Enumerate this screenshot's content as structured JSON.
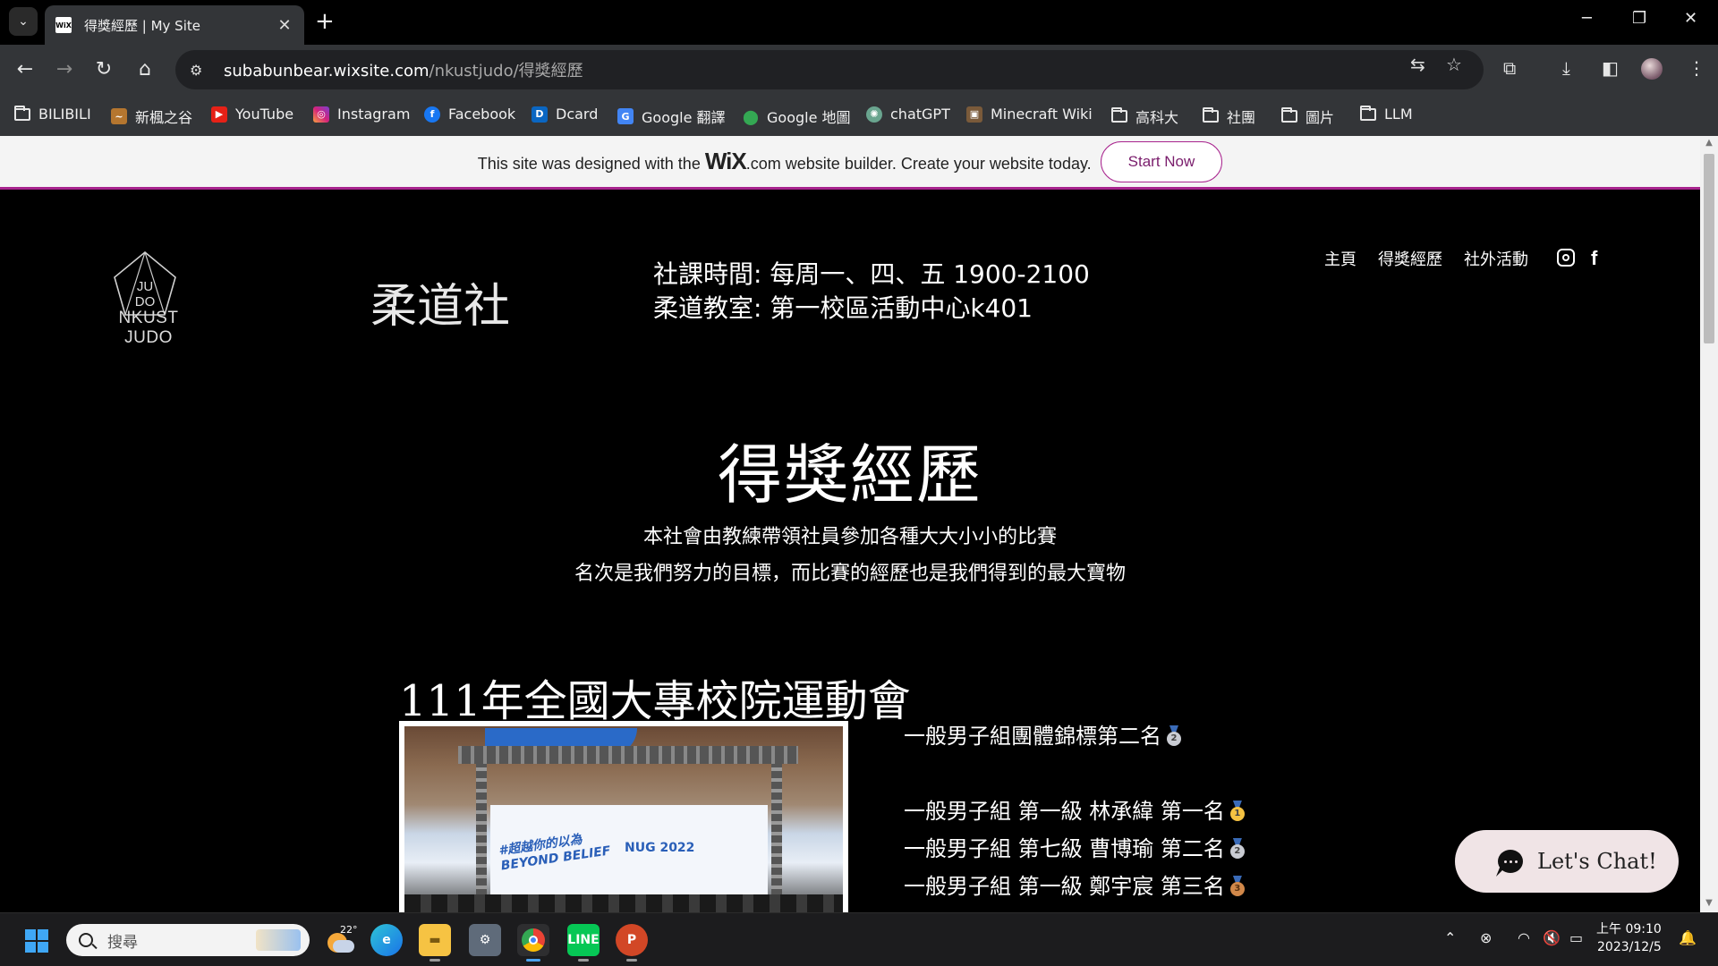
{
  "browser": {
    "tab_title": "得獎經歷 | My Site",
    "tab_favicon": "WiX",
    "url_host": "subabunbear.wixsite.com",
    "url_path": "/nkustjudo/得獎經歷",
    "bookmarks": [
      {
        "label": "BILIBILI",
        "icon": "folder-icon"
      },
      {
        "label": "新楓之谷",
        "icon": "maplestory-icon"
      },
      {
        "label": "YouTube",
        "icon": "youtube-icon"
      },
      {
        "label": "Instagram",
        "icon": "instagram-icon"
      },
      {
        "label": "Facebook",
        "icon": "facebook-icon"
      },
      {
        "label": "Dcard",
        "icon": "dcard-icon"
      },
      {
        "label": "Google 翻譯",
        "icon": "google-translate-icon"
      },
      {
        "label": "Google 地圖",
        "icon": "google-maps-icon"
      },
      {
        "label": "chatGPT",
        "icon": "chatgpt-icon"
      },
      {
        "label": "Minecraft Wiki",
        "icon": "minecraft-icon"
      },
      {
        "label": "高科大",
        "icon": "folder-icon"
      },
      {
        "label": "社團",
        "icon": "folder-icon"
      },
      {
        "label": "圖片",
        "icon": "folder-icon"
      },
      {
        "label": "LLM",
        "icon": "folder-icon"
      }
    ]
  },
  "wix_banner": {
    "text_before": "This site was designed with the",
    "logo": "WiX",
    "logo_suffix": ".com",
    "text_after": "website builder. Create your website today.",
    "cta": "Start Now",
    "accent_color": "#a8248e"
  },
  "site": {
    "logo_mark_top": "JU",
    "logo_mark_bottom": "DO",
    "logo_text": "NKUST JUDO",
    "club_name": "柔道社",
    "info_line1": "社課時間: 每周一、四、五 1900-2100",
    "info_line2": "柔道教室: 第一校區活動中心k401",
    "nav": [
      "主頁",
      "得獎經歷",
      "社外活動"
    ],
    "social": [
      "instagram-icon",
      "facebook-icon"
    ]
  },
  "page": {
    "title": "得獎經歷",
    "intro_line1": "本社會由教練帶領社員參加各種大大小小的比賽",
    "intro_line2": "名次是我們努力的目標，而比賽的經歷也是我們得到的最大寶物",
    "event": {
      "title": "111年全國大專校院運動會",
      "photo_banner_left": "#超越你的以為",
      "photo_banner_left2": "BEYOND BELIEF",
      "photo_banner_right": "NUG 2022",
      "results": [
        {
          "text": "一般男子組團體錦標第二名",
          "medal": "2"
        },
        {
          "text": "一般男子組 第一級 林承緯 第一名",
          "medal": "1"
        },
        {
          "text": "一般男子組 第七級 曹博瑜 第二名",
          "medal": "2"
        },
        {
          "text": "一般男子組 第一級 鄭宇宸 第三名",
          "medal": "3"
        }
      ]
    }
  },
  "chat": {
    "label": "Let's Chat!"
  },
  "taskbar": {
    "search_placeholder": "搜尋",
    "weather_temp": "22°",
    "clock_line1": "上午 09:10",
    "clock_line2": "2023/12/5"
  }
}
